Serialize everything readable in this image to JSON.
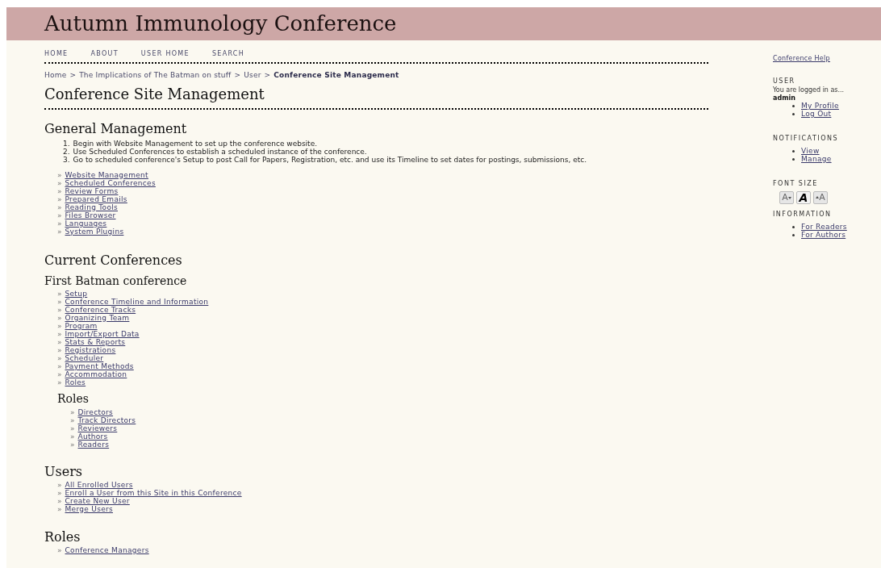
{
  "header": {
    "title": "Autumn Immunology Conference"
  },
  "nav": [
    "HOME",
    "ABOUT",
    "USER HOME",
    "SEARCH"
  ],
  "breadcrumb": {
    "items": [
      "Home",
      "The Implications of The Batman on stuff",
      "User"
    ],
    "separator": ">",
    "current": "Conference Site Management"
  },
  "page_title": "Conference Site Management",
  "general_management": {
    "heading": "General Management",
    "steps": [
      {
        "number": "1.",
        "text": "Begin with Website Management to set up the conference website."
      },
      {
        "number": "2.",
        "text": "Use Scheduled Conferences to establish a scheduled instance of the conference."
      },
      {
        "number": "3.",
        "text": "Go to scheduled conference's Setup to post Call for Papers, Registration, etc. and use its Timeline to set dates for postings, submissions, etc."
      }
    ],
    "links": [
      "Website Management",
      "Scheduled Conferences",
      "Review Forms",
      "Prepared Emails",
      "Reading Tools",
      "Files Browser",
      "Languages",
      "System Plugins"
    ]
  },
  "current_conferences": {
    "heading": "Current Conferences",
    "conference": {
      "name": "First Batman conference",
      "links": [
        "Setup",
        "Conference Timeline and Information",
        "Conference Tracks",
        "Organizing Team",
        "Program",
        "Import/Export Data",
        "Stats & Reports",
        "Registrations",
        "Scheduler",
        "Payment Methods",
        "Accommodation",
        "Roles"
      ],
      "roles_heading": "Roles",
      "roles": [
        "Directors",
        "Track Directors",
        "Reviewers",
        "Authors",
        "Readers"
      ]
    }
  },
  "users": {
    "heading": "Users",
    "links": [
      "All Enrolled Users",
      "Enroll a User from this Site in this Conference",
      "Create New User",
      "Merge Users"
    ]
  },
  "roles": {
    "heading": "Roles",
    "links": [
      "Conference Managers"
    ]
  },
  "link_marker": "»",
  "sidebar": {
    "help_link": "Conference Help",
    "user": {
      "heading": "USER",
      "logged_in_text": "You are logged in as...",
      "username": "admin",
      "links": [
        "My Profile",
        "Log Out"
      ]
    },
    "notifications": {
      "heading": "NOTIFICATIONS",
      "links": [
        "View",
        "Manage"
      ]
    },
    "font_size": {
      "heading": "FONT SIZE",
      "buttons": [
        {
          "kind": "smaller",
          "label": "A"
        },
        {
          "kind": "default",
          "label": "A"
        },
        {
          "kind": "larger",
          "label": "A"
        }
      ]
    },
    "information": {
      "heading": "INFORMATION",
      "links": [
        "For Readers",
        "For Authors"
      ]
    }
  }
}
